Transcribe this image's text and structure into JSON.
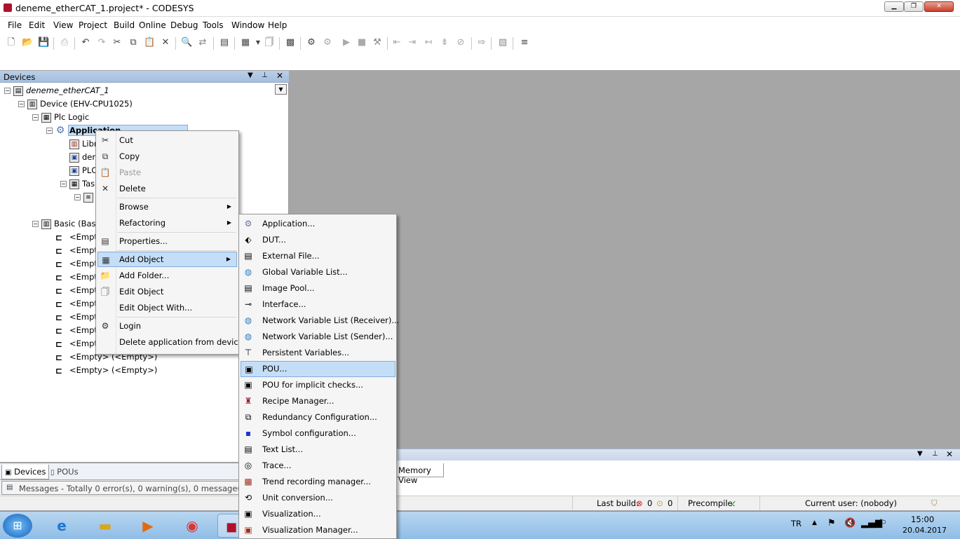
{
  "window": {
    "title": "deneme_etherCAT_1.project* - CODESYS"
  },
  "menubar": [
    "File",
    "Edit",
    "View",
    "Project",
    "Build",
    "Online",
    "Debug",
    "Tools",
    "Window",
    "Help"
  ],
  "devices_panel": {
    "title": "Devices",
    "tree": [
      {
        "label": "deneme_etherCAT_1",
        "icon": "project-icon",
        "level": 0,
        "expander": "−"
      },
      {
        "label": "Device (EHV-CPU1025)",
        "icon": "device-icon",
        "level": 1,
        "expander": "−"
      },
      {
        "label": "Plc Logic",
        "icon": "plc-logic-icon",
        "level": 2,
        "expander": "−"
      },
      {
        "label": "Application",
        "icon": "application-gear-icon",
        "level": 3,
        "expander": "−"
      },
      {
        "label": "Libr",
        "icon": "library-icon",
        "level": 4,
        "expander": ""
      },
      {
        "label": "den",
        "icon": "pou-icon",
        "level": 4,
        "expander": ""
      },
      {
        "label": "PLC",
        "icon": "pou-icon",
        "level": 4,
        "expander": ""
      },
      {
        "label": "Tas",
        "icon": "task-icon",
        "level": 4,
        "expander": "−"
      },
      {
        "label": "",
        "icon": "task-item-icon",
        "level": 5,
        "expander": "−"
      },
      {
        "label": "",
        "icon": "",
        "level": 5,
        "expander": ""
      },
      {
        "label": "Basic (Basic",
        "icon": "basic-module-icon",
        "level": 2,
        "expander": "−"
      },
      {
        "label": "<Empt",
        "icon": "slot-icon",
        "level": 3,
        "expander": ""
      },
      {
        "label": "<Empt",
        "icon": "slot-icon",
        "level": 3,
        "expander": ""
      },
      {
        "label": "<Empt",
        "icon": "slot-icon",
        "level": 3,
        "expander": ""
      },
      {
        "label": "<Empt",
        "icon": "slot-icon",
        "level": 3,
        "expander": ""
      },
      {
        "label": "<Empt",
        "icon": "slot-icon",
        "level": 3,
        "expander": ""
      },
      {
        "label": "<Empt",
        "icon": "slot-icon",
        "level": 3,
        "expander": ""
      },
      {
        "label": "<Empt",
        "icon": "slot-icon",
        "level": 3,
        "expander": ""
      },
      {
        "label": "<Empt",
        "icon": "slot-icon",
        "level": 3,
        "expander": ""
      },
      {
        "label": "<Empt",
        "icon": "slot-icon",
        "level": 3,
        "expander": ""
      },
      {
        "label": "<Empty> (<Empty>)",
        "icon": "slot-icon",
        "level": 3,
        "expander": ""
      },
      {
        "label": "<Empty> (<Empty>)",
        "icon": "slot-icon",
        "level": 3,
        "expander": ""
      }
    ]
  },
  "bottom_tabs": {
    "devices": "Devices",
    "pous": "POUs",
    "memory_view": "Memory View"
  },
  "messages": {
    "label": "Messages - Totally 0 error(s), 0 warning(s), 0 message(s)"
  },
  "statusbar": {
    "last_build_label": "Last build:",
    "errors": "0",
    "warnings": "0",
    "precompile_label": "Precompile:",
    "current_user": "Current user: (nobody)"
  },
  "context_menu": {
    "items": [
      {
        "label": "Cut",
        "icon": "scissors-icon",
        "state": "normal"
      },
      {
        "label": "Copy",
        "icon": "copy-icon",
        "state": "normal"
      },
      {
        "label": "Paste",
        "icon": "paste-icon",
        "state": "disabled"
      },
      {
        "label": "Delete",
        "icon": "delete-x-icon",
        "state": "normal"
      },
      {
        "label": "Browse",
        "icon": "",
        "state": "submenu"
      },
      {
        "label": "Refactoring",
        "icon": "",
        "state": "submenu"
      },
      {
        "label": "Properties...",
        "icon": "properties-icon",
        "state": "normal"
      },
      {
        "label": "Add Object",
        "icon": "add-object-icon",
        "state": "highlighted"
      },
      {
        "label": "Add Folder...",
        "icon": "folder-icon",
        "state": "normal"
      },
      {
        "label": "Edit Object",
        "icon": "edit-object-icon",
        "state": "normal"
      },
      {
        "label": "Edit Object With...",
        "icon": "",
        "state": "normal"
      },
      {
        "label": "Login",
        "icon": "login-gear-icon",
        "state": "normal"
      },
      {
        "label": "Delete application from device",
        "icon": "",
        "state": "normal"
      }
    ]
  },
  "add_object_submenu": {
    "items": [
      {
        "label": "Application...",
        "icon": "application-gear-icon"
      },
      {
        "label": "DUT...",
        "icon": "dut-icon"
      },
      {
        "label": "External File...",
        "icon": "external-file-icon"
      },
      {
        "label": "Global Variable List...",
        "icon": "globe-icon"
      },
      {
        "label": "Image Pool...",
        "icon": "image-pool-icon"
      },
      {
        "label": "Interface...",
        "icon": "interface-icon"
      },
      {
        "label": "Network Variable List (Receiver)...",
        "icon": "globe-icon"
      },
      {
        "label": "Network Variable List (Sender)...",
        "icon": "globe-icon"
      },
      {
        "label": "Persistent Variables...",
        "icon": "persistent-icon"
      },
      {
        "label": "POU...",
        "icon": "pou-icon",
        "highlighted": true
      },
      {
        "label": "POU for implicit checks...",
        "icon": "pou-icon"
      },
      {
        "label": "Recipe Manager...",
        "icon": "recipe-icon"
      },
      {
        "label": "Redundancy Configuration...",
        "icon": "redundancy-icon"
      },
      {
        "label": "Symbol configuration...",
        "icon": "symbol-config-icon"
      },
      {
        "label": "Text List...",
        "icon": "text-list-icon"
      },
      {
        "label": "Trace...",
        "icon": "trace-icon"
      },
      {
        "label": "Trend recording manager...",
        "icon": "trend-icon"
      },
      {
        "label": "Unit conversion...",
        "icon": "unit-conversion-icon"
      },
      {
        "label": "Visualization...",
        "icon": "visualization-icon"
      },
      {
        "label": "Visualization Manager...",
        "icon": "visualization-manager-icon"
      }
    ]
  },
  "taskbar": {
    "language": "TR",
    "time": "15:00",
    "date": "20.04.2017"
  }
}
